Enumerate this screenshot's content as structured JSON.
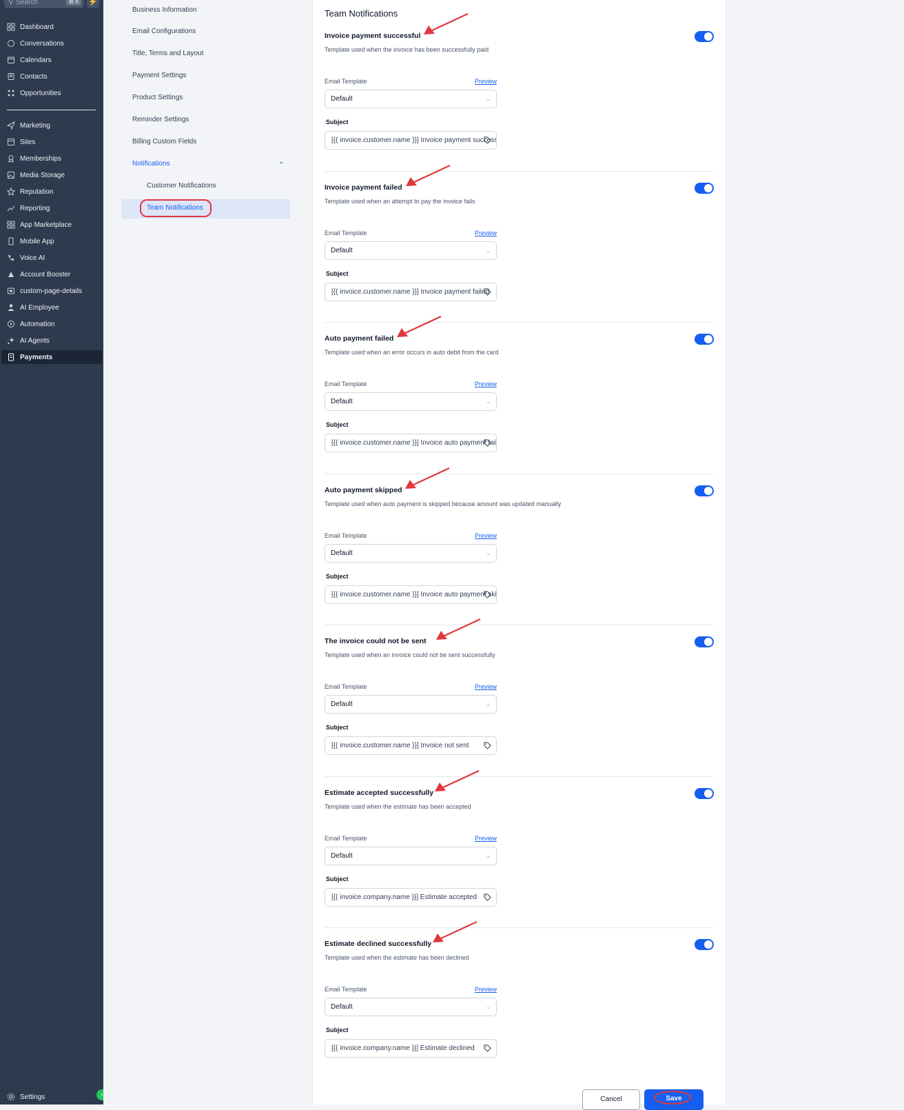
{
  "leftnav": {
    "search_placeholder": "Search",
    "search_shortcut": "⌘ K",
    "items": [
      {
        "label": "Dashboard",
        "icon": "grid-icon"
      },
      {
        "label": "Conversations",
        "icon": "chat-icon"
      },
      {
        "label": "Calendars",
        "icon": "calendar-icon"
      },
      {
        "label": "Contacts",
        "icon": "contacts-icon"
      },
      {
        "label": "Opportunities",
        "icon": "opportunities-icon"
      },
      {
        "label": "Marketing",
        "icon": "send-icon"
      },
      {
        "label": "Sites",
        "icon": "sites-icon"
      },
      {
        "label": "Memberships",
        "icon": "award-icon"
      },
      {
        "label": "Media Storage",
        "icon": "image-icon"
      },
      {
        "label": "Reputation",
        "icon": "star-icon"
      },
      {
        "label": "Reporting",
        "icon": "trend-icon"
      },
      {
        "label": "App Marketplace",
        "icon": "apps-icon"
      },
      {
        "label": "Mobile App",
        "icon": "phone-icon"
      },
      {
        "label": "Voice AI",
        "icon": "call-icon"
      },
      {
        "label": "Account Booster",
        "icon": "booster-icon"
      },
      {
        "label": "custom-page-details",
        "icon": "page-icon"
      },
      {
        "label": "AI Employee",
        "icon": "person-icon"
      },
      {
        "label": "Automation",
        "icon": "automation-icon"
      },
      {
        "label": "AI Agents",
        "icon": "sparkle-icon"
      },
      {
        "label": "Payments",
        "icon": "payments-icon",
        "active": true
      }
    ],
    "settings_label": "Settings"
  },
  "subnav": {
    "items": [
      "Business Information",
      "Email Configurations",
      "Title, Terms and Layout",
      "Payment Settings",
      "Product Settings",
      "Reminder Settings",
      "Billing Custom Fields"
    ],
    "notifications_label": "Notifications",
    "children": [
      "Customer Notifications",
      "Team Notifications"
    ],
    "active_child": "Team Notifications"
  },
  "main": {
    "title": "Team Notifications",
    "email_template_label": "Email Template",
    "preview_label": "Preview",
    "subject_label": "Subject",
    "sections": [
      {
        "title": "Invoice payment successful",
        "description": "Template used when the invoice has been successfully paid",
        "enabled": true,
        "template": "Default",
        "subject": "[{{ invoice.customer.name }}] Invoice payment successful"
      },
      {
        "title": "Invoice payment failed",
        "description": "Template used when an attempt to pay the invoice fails",
        "enabled": true,
        "template": "Default",
        "subject": "[{{ invoice.customer.name }}] Invoice payment failed"
      },
      {
        "title": "Auto payment failed",
        "description": "Template used when an error occurs in auto debit from the card",
        "enabled": true,
        "template": "Default",
        "subject": "[{{ invoice.customer.name }}] Invoice auto payment failed"
      },
      {
        "title": "Auto payment skipped",
        "description": "Template used when auto payment is skipped because amount was updated manually",
        "enabled": true,
        "template": "Default",
        "subject": "[{{ invoice.customer.name }}] Invoice auto payment skipped"
      },
      {
        "title": "The invoice could not be sent",
        "description": "Template used when an invoice could not be sent successfully",
        "enabled": true,
        "template": "Default",
        "subject": "[{{ invoice.customer.name }}]  Invoice not sent"
      },
      {
        "title": "Estimate accepted successfully",
        "description": "Template used when the estimate has been accepted",
        "enabled": true,
        "template": "Default",
        "subject": "[{{ invoice.company.name }}] Estimate accepted"
      },
      {
        "title": "Estimate declined successfully",
        "description": "Template used when the estimate has been declined",
        "enabled": true,
        "template": "Default",
        "subject": "[{{ invoice.company.name }}] Estimate declined"
      }
    ],
    "cancel_label": "Cancel",
    "save_label": "Save"
  },
  "colors": {
    "sidebar_bg": "#2e3a4d",
    "primary": "#155eef",
    "annotation_red": "#e0383e"
  }
}
